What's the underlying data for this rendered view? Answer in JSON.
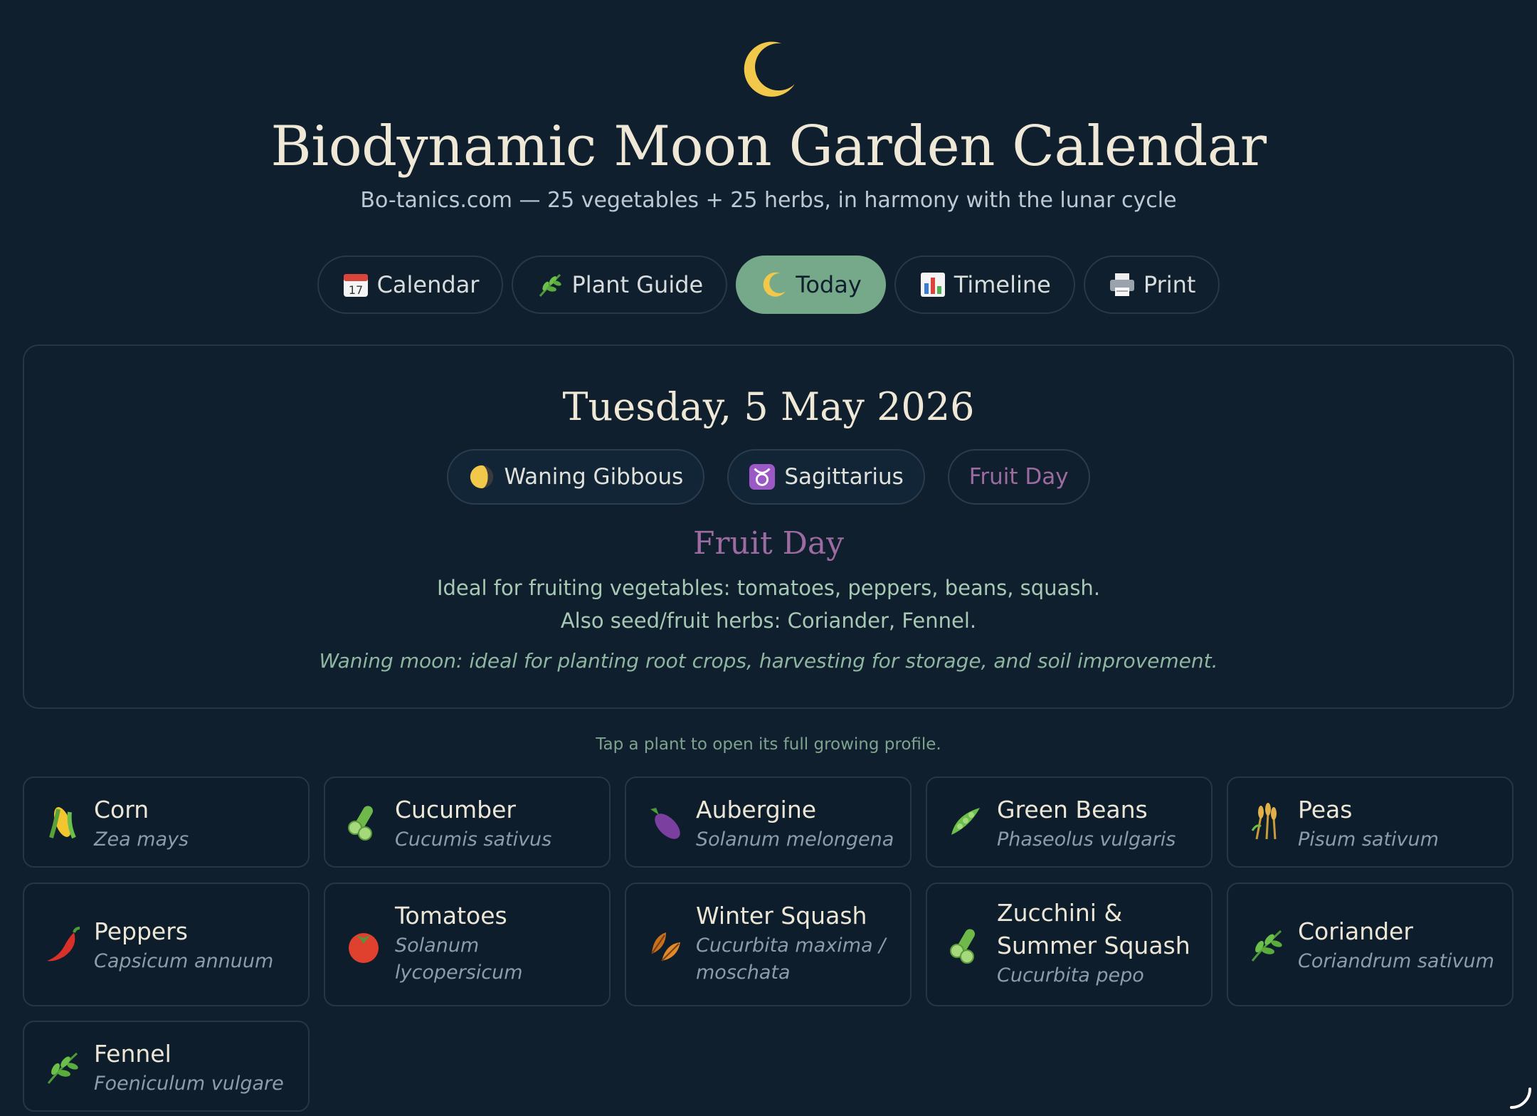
{
  "header": {
    "logo_icon": "crescent-moon-icon",
    "title": "Biodynamic Moon Garden Calendar",
    "subtitle": "Bo-tanics.com — 25 vegetables + 25 herbs, in harmony with the lunar cycle"
  },
  "nav": {
    "items": [
      {
        "label": "Calendar",
        "icon": "calendar-icon",
        "active": false
      },
      {
        "label": "Plant Guide",
        "icon": "herb-icon",
        "active": false
      },
      {
        "label": "Today",
        "icon": "crescent-moon-icon",
        "active": true
      },
      {
        "label": "Timeline",
        "icon": "bar-chart-icon",
        "active": false
      },
      {
        "label": "Print",
        "icon": "printer-icon",
        "active": false
      }
    ],
    "active_color": "#76a98a"
  },
  "today": {
    "date": "Tuesday, 5 May 2026",
    "moon_phase": "Waning Gibbous",
    "zodiac": "Sagittarius",
    "day_type_badge": "Fruit Day",
    "day_type_title": "Fruit Day",
    "description_line1": "Ideal for fruiting vegetables: tomatoes, peppers, beans, squash.",
    "description_line2": "Also seed/fruit herbs: Coriander, Fennel.",
    "moon_note": "Waning moon: ideal for planting root crops, harvesting for storage, and soil improvement.",
    "fruit_color": "#9c6ba0"
  },
  "tap_hint": "Tap a plant to open its full growing profile.",
  "plants": [
    {
      "name": "Corn",
      "latin": "Zea mays",
      "icon": "corn-icon"
    },
    {
      "name": "Cucumber",
      "latin": "Cucumis sativus",
      "icon": "cucumber-icon"
    },
    {
      "name": "Aubergine",
      "latin": "Solanum melongena",
      "icon": "eggplant-icon"
    },
    {
      "name": "Green Beans",
      "latin": "Phaseolus vulgaris",
      "icon": "bean-pod-icon"
    },
    {
      "name": "Peas",
      "latin": "Pisum sativum",
      "icon": "grain-sheaf-icon"
    },
    {
      "name": "Peppers",
      "latin": "Capsicum annuum",
      "icon": "chili-pepper-icon"
    },
    {
      "name": "Tomatoes",
      "latin": "Solanum lycopersicum",
      "icon": "tomato-icon"
    },
    {
      "name": "Winter Squash",
      "latin": "Cucurbita maxima / moschata",
      "icon": "autumn-leaves-icon"
    },
    {
      "name": "Zucchini & Summer Squash",
      "latin": "Cucurbita pepo",
      "icon": "cucumber-icon"
    },
    {
      "name": "Coriander",
      "latin": "Coriandrum sativum",
      "icon": "herb-icon"
    },
    {
      "name": "Fennel",
      "latin": "Foeniculum vulgare",
      "icon": "herb-icon"
    }
  ]
}
